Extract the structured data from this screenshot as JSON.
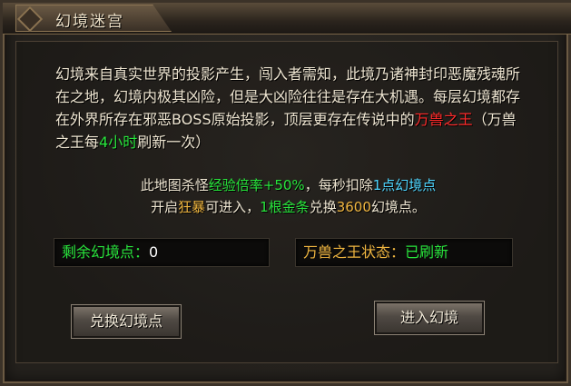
{
  "window": {
    "title": "幻境迷宫"
  },
  "description": {
    "p1": "幻境来自真实世界的投影产生，闯入者需知，此境乃诸神封印恶魔残魂所在之地，幻境内极其凶险，但是大凶险往往是存在大机遇。每层幻境都存在外界所存在邪恶BOSS原始投影，顶层更存在传说中的",
    "boss": "万兽之王",
    "p2": "（万兽之王每",
    "hours": "4小时",
    "p3": "刷新一次）"
  },
  "info_line1": {
    "a": "此地图杀怪",
    "exp": "经验倍率+50%",
    "b": "，每秒扣除",
    "deduct": "1点幻境点"
  },
  "info_line2": {
    "a": "开启",
    "rage": "狂暴",
    "b": "可进入，",
    "gold": "1根金条",
    "c": "兑换",
    "points": "3600",
    "d": "幻境点。"
  },
  "stats": {
    "remaining_label": "剩余幻境点：",
    "remaining_value": "0",
    "boss_status_label": "万兽之王状态：",
    "boss_status_value": "已刷新"
  },
  "buttons": {
    "exchange": "兑换幻境点",
    "enter": "进入幻境"
  }
}
